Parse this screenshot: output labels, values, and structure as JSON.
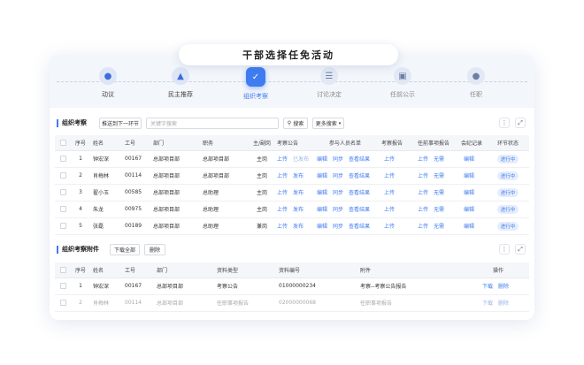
{
  "page_title": "干部选择任免活动",
  "steps": [
    {
      "label": "动议",
      "state": "done",
      "icon": "person-icon"
    },
    {
      "label": "民主推荐",
      "state": "done",
      "icon": "vote-icon"
    },
    {
      "label": "组织考察",
      "state": "active",
      "icon": "clipboard-icon"
    },
    {
      "label": "讨论决定",
      "state": "todo",
      "icon": "discuss-icon"
    },
    {
      "label": "任前公示",
      "state": "todo",
      "icon": "briefcase-icon"
    },
    {
      "label": "任职",
      "state": "todo",
      "icon": "appoint-icon"
    }
  ],
  "inspection": {
    "title": "组织考察",
    "push_button": "推送到下一环节",
    "search_placeholder": "关键字搜索",
    "search_button": "搜索",
    "more_search": "更多搜索",
    "columns": [
      "序号",
      "姓名",
      "工号",
      "部门",
      "职务",
      "主/副岗",
      "考察公告",
      "参与人员名单",
      "考察报告",
      "任前事项报告",
      "会纪记录",
      "环节状态"
    ],
    "rows": [
      {
        "no": "1",
        "name": "钟宏深",
        "id": "00167",
        "dept": "总部项目部",
        "pos": "总部项目部",
        "post": "主岗",
        "notice": [
          "上传",
          "已发布"
        ],
        "members": [
          "编辑",
          "同步",
          "查看结果"
        ],
        "report": "上传",
        "pre": [
          "上传",
          "无需"
        ],
        "minutes": "编辑",
        "status": "进行中"
      },
      {
        "no": "2",
        "name": "肖梅林",
        "id": "00114",
        "dept": "总部项目部",
        "pos": "总部项目部",
        "post": "主岗",
        "notice": [
          "上传",
          "发布"
        ],
        "members": [
          "编辑",
          "同步",
          "查看结果"
        ],
        "report": "上传",
        "pre": [
          "上传",
          "无需"
        ],
        "minutes": "编辑",
        "status": "进行中"
      },
      {
        "no": "3",
        "name": "翟小玉",
        "id": "00585",
        "dept": "总部项目部",
        "pos": "总助理",
        "post": "主岗",
        "notice": [
          "上传",
          "发布"
        ],
        "members": [
          "编辑",
          "同步",
          "查看结果"
        ],
        "report": "上传",
        "pre": [
          "上传",
          "无需"
        ],
        "minutes": "编辑",
        "status": "进行中"
      },
      {
        "no": "4",
        "name": "朱龙",
        "id": "00975",
        "dept": "总部项目部",
        "pos": "总助理",
        "post": "主岗",
        "notice": [
          "上传",
          "发布"
        ],
        "members": [
          "编辑",
          "同步",
          "查看结果"
        ],
        "report": "上传",
        "pre": [
          "上传",
          "无需"
        ],
        "minutes": "编辑",
        "status": "进行中"
      },
      {
        "no": "5",
        "name": "张磊",
        "id": "00189",
        "dept": "总部项目部",
        "pos": "总助理",
        "post": "兼岗",
        "notice": [
          "上传",
          "发布"
        ],
        "members": [
          "编辑",
          "同步",
          "查看结果"
        ],
        "report": "上传",
        "pre": [
          "上传",
          "无需"
        ],
        "minutes": "编辑",
        "status": "进行中"
      }
    ]
  },
  "attachments": {
    "title": "组织考察附件",
    "download_all": "下载全部",
    "delete": "删除",
    "columns": [
      "序号",
      "姓名",
      "工号",
      "部门",
      "资料类型",
      "资料编号",
      "附件",
      "操作"
    ],
    "rows": [
      {
        "no": "1",
        "name": "钟宏深",
        "id": "00167",
        "dept": "总部项目部",
        "type": "考察公告",
        "code": "01000000234",
        "file": "考察--考察公告报告",
        "ops": [
          "下载",
          "删除"
        ]
      },
      {
        "no": "2",
        "name": "肖梅林",
        "id": "00114",
        "dept": "总部项目部",
        "type": "任职事项报告",
        "code": "02000000068",
        "file": "任职事项报告",
        "ops": [
          "下载",
          "删除"
        ]
      }
    ]
  }
}
